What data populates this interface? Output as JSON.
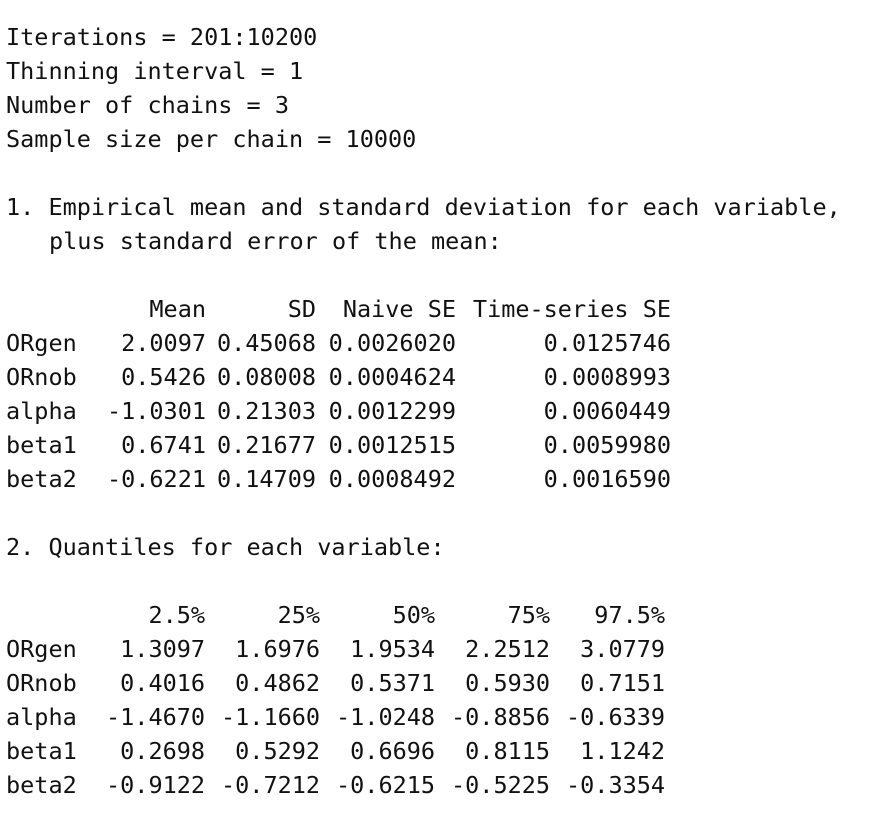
{
  "header": {
    "iterations": "Iterations = 201:10200",
    "thinning": "Thinning interval = 1",
    "chains": "Number of chains = 3",
    "sample_size": "Sample size per chain = 10000"
  },
  "section1": {
    "title_line1": "1. Empirical mean and standard deviation for each variable,",
    "title_line2": "plus standard error of the mean:",
    "columns": [
      "Mean",
      "SD",
      "Naive SE",
      "Time-series SE"
    ],
    "rows": [
      {
        "name": "ORgen",
        "values": [
          "2.0097",
          "0.45068",
          "0.0026020",
          "0.0125746"
        ]
      },
      {
        "name": "ORnob",
        "values": [
          "0.5426",
          "0.08008",
          "0.0004624",
          "0.0008993"
        ]
      },
      {
        "name": "alpha",
        "values": [
          "-1.0301",
          "0.21303",
          "0.0012299",
          "0.0060449"
        ]
      },
      {
        "name": "beta1",
        "values": [
          "0.6741",
          "0.21677",
          "0.0012515",
          "0.0059980"
        ]
      },
      {
        "name": "beta2",
        "values": [
          "-0.6221",
          "0.14709",
          "0.0008492",
          "0.0016590"
        ]
      }
    ]
  },
  "section2": {
    "title": "2. Quantiles for each variable:",
    "columns": [
      "2.5%",
      "25%",
      "50%",
      "75%",
      "97.5%"
    ],
    "rows": [
      {
        "name": "ORgen",
        "values": [
          "1.3097",
          "1.6976",
          "1.9534",
          "2.2512",
          "3.0779"
        ]
      },
      {
        "name": "ORnob",
        "values": [
          "0.4016",
          "0.4862",
          "0.5371",
          "0.5930",
          "0.7151"
        ]
      },
      {
        "name": "alpha",
        "values": [
          "-1.4670",
          "-1.1660",
          "-1.0248",
          "-0.8856",
          "-0.6339"
        ]
      },
      {
        "name": "beta1",
        "values": [
          "0.2698",
          "0.5292",
          "0.6696",
          "0.8115",
          "1.1242"
        ]
      },
      {
        "name": "beta2",
        "values": [
          "-0.9122",
          "-0.7212",
          "-0.6215",
          "-0.5225",
          "-0.3354"
        ]
      }
    ]
  }
}
